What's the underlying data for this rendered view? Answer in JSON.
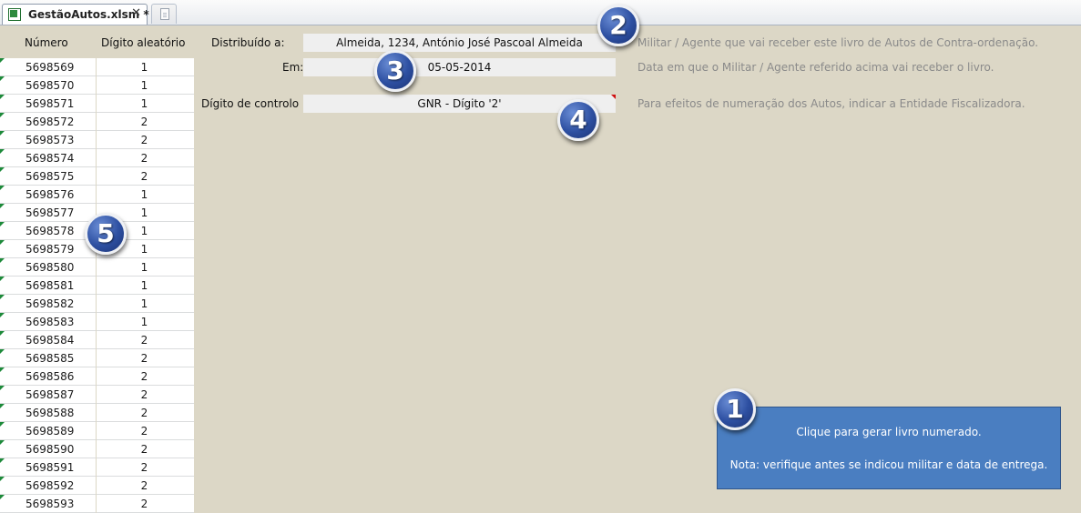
{
  "tab": {
    "title": "GestãoAutos.xlsm *",
    "close_symbol": "✕"
  },
  "headers": {
    "numero": "Número",
    "digito": "Dígito aleatório"
  },
  "rows": [
    {
      "n": "5698569",
      "d": "1"
    },
    {
      "n": "5698570",
      "d": "1"
    },
    {
      "n": "5698571",
      "d": "1"
    },
    {
      "n": "5698572",
      "d": "2"
    },
    {
      "n": "5698573",
      "d": "2"
    },
    {
      "n": "5698574",
      "d": "2"
    },
    {
      "n": "5698575",
      "d": "2"
    },
    {
      "n": "5698576",
      "d": "1"
    },
    {
      "n": "5698577",
      "d": "1"
    },
    {
      "n": "5698578",
      "d": "1"
    },
    {
      "n": "5698579",
      "d": "1"
    },
    {
      "n": "5698580",
      "d": "1"
    },
    {
      "n": "5698581",
      "d": "1"
    },
    {
      "n": "5698582",
      "d": "1"
    },
    {
      "n": "5698583",
      "d": "1"
    },
    {
      "n": "5698584",
      "d": "2"
    },
    {
      "n": "5698585",
      "d": "2"
    },
    {
      "n": "5698586",
      "d": "2"
    },
    {
      "n": "5698587",
      "d": "2"
    },
    {
      "n": "5698588",
      "d": "2"
    },
    {
      "n": "5698589",
      "d": "2"
    },
    {
      "n": "5698590",
      "d": "2"
    },
    {
      "n": "5698591",
      "d": "2"
    },
    {
      "n": "5698592",
      "d": "2"
    },
    {
      "n": "5698593",
      "d": "2"
    }
  ],
  "form": {
    "distribuido_label": "Distribuído a:",
    "distribuido_value": "Almeida, 1234, António José Pascoal Almeida",
    "distribuido_hint": "Militar / Agente que vai receber este livro de Autos de Contra-ordenação.",
    "em_label": "Em:",
    "em_value": "05-05-2014",
    "em_hint": "Data em que o Militar / Agente referido acima vai receber o livro.",
    "digito_label": "Dígito de controlo",
    "digito_value": "GNR - Dígito '2'",
    "digito_hint": "Para efeitos de numeração dos Autos, indicar a Entidade Fiscalizadora."
  },
  "action": {
    "line1": "Clique para gerar livro numerado.",
    "line2": "Nota: verifique antes se indicou militar e data de entrega."
  },
  "callouts": {
    "one": "1",
    "two": "2",
    "three": "3",
    "four": "4",
    "five": "5"
  },
  "colors": {
    "background": "#dcd7c6",
    "button": "#4a7ec1",
    "badge": "#2d4fa1",
    "hint_text": "#8a8a8a"
  }
}
